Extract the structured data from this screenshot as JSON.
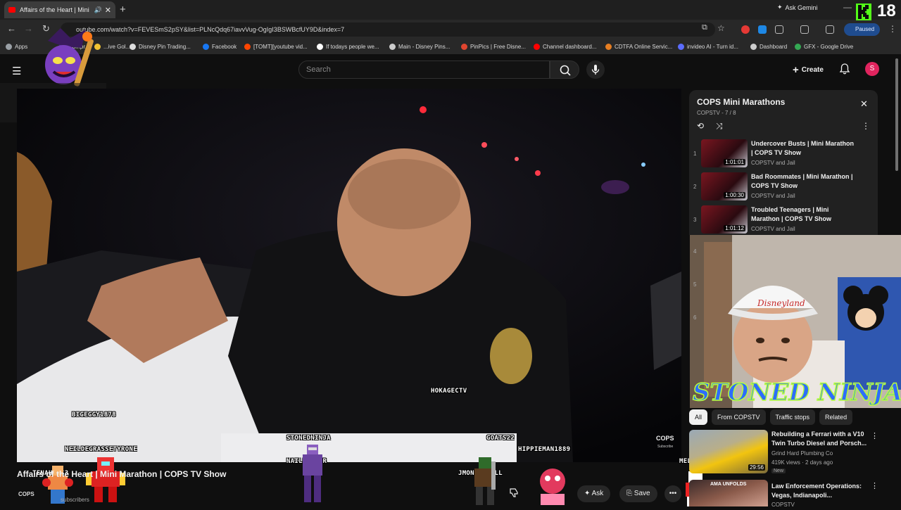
{
  "browser": {
    "tab_title": "Affairs of the Heart | Mini M",
    "new_tab_icon": "plus-icon",
    "gemini_label": "Ask Gemini",
    "url": "outube.com/watch?v=FEVESmS2pSY&list=PLNcQdq67iavvVug-OgIgI3BSWBcfUY9D&index=7",
    "profile_status": "Paused"
  },
  "bookmarks": [
    {
      "label": "Apps",
      "color": "#9aa0a6"
    },
    {
      "label": "Compr...",
      "color": "#4285f4"
    },
    {
      "label": "...ive Gol...",
      "color": "#f1c232"
    },
    {
      "label": "Disney Pin Trading...",
      "color": "#dddddd"
    },
    {
      "label": "Facebook",
      "color": "#1877f2"
    },
    {
      "label": "[TOMT][youtube vid...",
      "color": "#ff4500"
    },
    {
      "label": "If todays people we...",
      "color": "#ffffff"
    },
    {
      "label": "Main - Disney Pins...",
      "color": "#cccccc"
    },
    {
      "label": "PinPics | Free Disne...",
      "color": "#e0452f"
    },
    {
      "label": "Channel dashboard...",
      "color": "#ff0000"
    },
    {
      "label": "CDTFA Online Servic...",
      "color": "#e67e22"
    },
    {
      "label": "invideo AI - Turn id...",
      "color": "#5b6cff"
    },
    {
      "label": "Dashboard",
      "color": "#cccccc"
    },
    {
      "label": "GFX - Google Drive",
      "color": "#34a853"
    }
  ],
  "youtube": {
    "search_placeholder": "Search",
    "create_label": "Create",
    "avatar_letter": "S",
    "video_title": "Affairs of the Heart | Mini Marathon | COPS TV Show",
    "channel_short": "COPS",
    "subscribers_label": "subscribers",
    "ask_label": "Ask",
    "save_label": "Save",
    "watermark": "COPS",
    "watermark_sub": "Subscribe"
  },
  "overlay_names": [
    "BIGEGGY1878",
    "NEILDEGRASSETYRONE",
    "HOKAGECTV",
    "STONEDNINJA",
    "NAILBEATER",
    "GOATS22",
    "HIPPIEMAN1889",
    "JMONEYTRILL",
    "MELTABTHC",
    "TENAHERS3"
  ],
  "playlist": {
    "title": "COPS Mini Marathons",
    "subtitle": "COPSTV - 7 / 8",
    "items": [
      {
        "num": "1",
        "title": "Undercover Busts | Mini Marathon | COPS TV Show",
        "channel": "COPSTV and Jail",
        "duration": "1:01:01"
      },
      {
        "num": "2",
        "title": "Bad Roommates | Mini Marathon | COPS TV Show",
        "channel": "COPSTV and Jail",
        "duration": "1:00:30"
      },
      {
        "num": "3",
        "title": "Troubled Teenagers | Mini Marathon | COPS TV Show",
        "channel": "COPSTV and Jail",
        "duration": "1:01:12"
      }
    ],
    "hidden_nums": [
      "4",
      "5",
      "6"
    ]
  },
  "webcam": {
    "streamer_text": "STONED NINJA",
    "hat_text": "Disneyland"
  },
  "chips": [
    "All",
    "From COPSTV",
    "Traffic stops",
    "Related"
  ],
  "recommendations": [
    {
      "title": "Rebuilding a Ferrari with a V10 Twin Turbo Diesel and Porsch...",
      "channel": "Grind Hard Plumbing Co",
      "meta": "419K views · 2 days ago",
      "badge": "New",
      "duration": "29:56"
    },
    {
      "title": "Law Enforcement Operations: Vegas, Indianapoli...",
      "channel": "COPSTV",
      "thumb_text": "AMA UNFOLDS"
    }
  ],
  "stream": {
    "viewer_count": "18"
  }
}
